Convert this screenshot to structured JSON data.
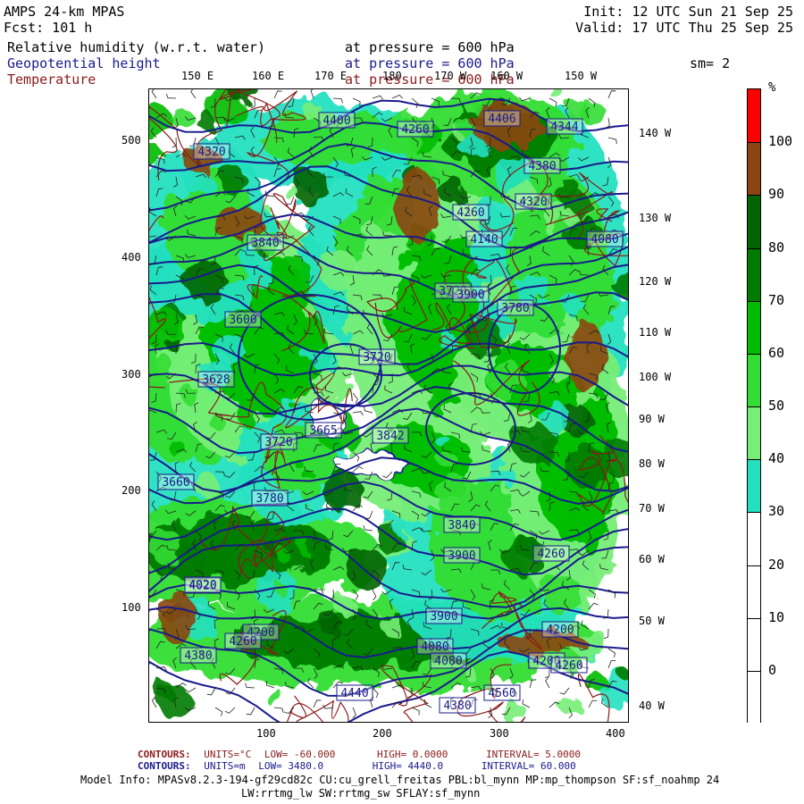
{
  "header": {
    "model": "AMPS 24-km MPAS",
    "fcst": "Fcst:  101 h",
    "init": "Init: 12 UTC Sun 21 Sep 25",
    "valid": "Valid: 17 UTC Thu 25 Sep 25",
    "fields": [
      {
        "name": "Relative humidity (w.r.t. water)",
        "level": "at pressure =  600 hPa",
        "color": "#000000"
      },
      {
        "name": "Geopotential height",
        "level": "at pressure =  600 hPa",
        "color": "#1a1a8c"
      },
      {
        "name": "Temperature",
        "level": "at pressure =  600 hPa",
        "color": "#8b1a1a"
      }
    ],
    "smoothing": "sm= 2"
  },
  "axes": {
    "x_ticks": [
      "100",
      "200",
      "300",
      "400"
    ],
    "y_ticks": [
      "500",
      "400",
      "300",
      "200",
      "100"
    ],
    "top_lon_labels": [
      "150 E",
      "160 E",
      "170 E",
      "180",
      "170 W",
      "160 W",
      "150 W"
    ],
    "right_lon_labels": [
      "140 W",
      "130 W",
      "120 W",
      "110 W",
      "100 W",
      "90 W",
      "80 W",
      "70 W",
      "60 W",
      "50 W",
      "40 W"
    ]
  },
  "colorbar": {
    "unit": "%",
    "labels": [
      "100",
      "90",
      "80",
      "70",
      "60",
      "50",
      "40",
      "30",
      "20",
      "10",
      "0"
    ],
    "segments": [
      {
        "color": "#ff0000"
      },
      {
        "color": "#8b4513"
      },
      {
        "color": "#006400"
      },
      {
        "color": "#007a00"
      },
      {
        "color": "#00bb00"
      },
      {
        "color": "#33dd33"
      },
      {
        "color": "#77ee77"
      },
      {
        "color": "#22e0c0"
      },
      {
        "color": "#ffffff"
      },
      {
        "color": "#ffffff"
      },
      {
        "color": "#ffffff"
      },
      {
        "color": "#ffffff"
      }
    ]
  },
  "height_labels": [
    "4400",
    "4260",
    "4406",
    "4344",
    "4320",
    "4380",
    "4320",
    "4260",
    "4140",
    "4080",
    "3840",
    "3720",
    "3900",
    "3780",
    "3600",
    "3720",
    "3628",
    "3665",
    "3720",
    "3842",
    "3660",
    "3780",
    "3840",
    "3900",
    "4020",
    "4260",
    "4200",
    "3900",
    "4080",
    "4080",
    "4200",
    "4200",
    "4260",
    "4380",
    "4440",
    "4380",
    "4560",
    "4260",
    "4020"
  ],
  "footer": {
    "line1": {
      "label": "CONTOURS:",
      "units": "UNITS=°C",
      "low": "LOW= -60.000",
      "high": "HIGH=  0.0000",
      "interval": "INTERVAL=   5.0000"
    },
    "line2": {
      "label": "CONTOURS:",
      "units": "UNITS=m",
      "low": "LOW=  3480.0",
      "high": "HIGH= 4440.0",
      "interval": "INTERVAL=   60.000"
    },
    "model_info": "Model Info: MPASv8.2.3-194-gf29cd82c CU:cu_grell_freitas PBL:bl_mynn MP:mp_thompson SF:sf_noahmp 24",
    "model_info2": "LW:rrtmg_lw SW:rrtmg_sw SFLAY:sf_mynn"
  }
}
